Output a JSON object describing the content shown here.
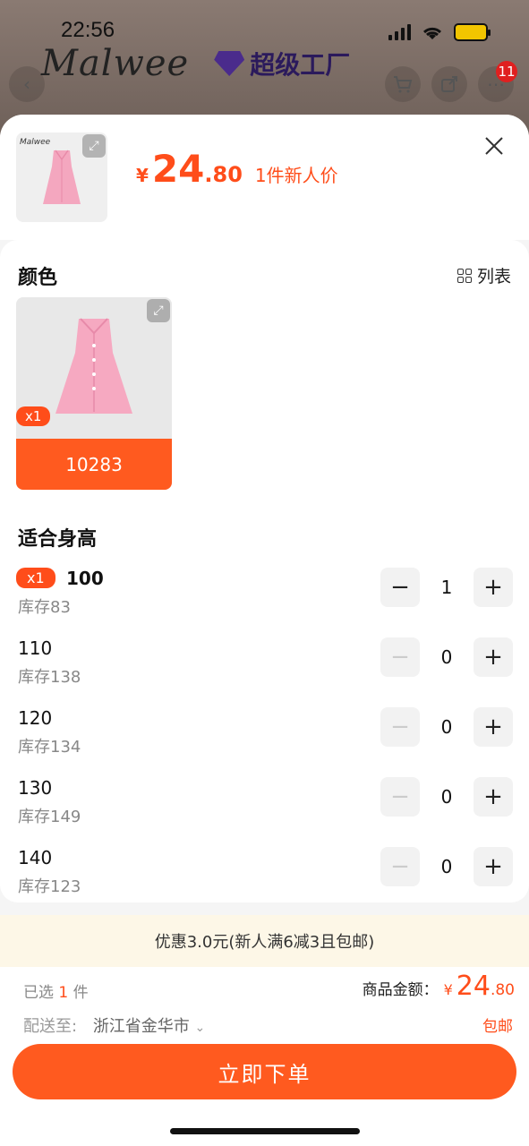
{
  "status": {
    "time": "22:56"
  },
  "brand": {
    "logo_text": "Malwee",
    "factory_label": "超级工厂"
  },
  "nav": {
    "cart_badge": "11"
  },
  "header": {
    "price_symbol": "¥",
    "price_int": "24",
    "price_dec": ".80",
    "price_note": "1件新人价"
  },
  "color_section": {
    "title": "颜色",
    "list_toggle_label": "列表",
    "option": {
      "label": "10283",
      "qty_tag": "x1"
    }
  },
  "size_section": {
    "title": "适合身高",
    "sizes": [
      {
        "name": "100",
        "stock": "库存83",
        "qty": "1",
        "tag": "x1",
        "selected": true
      },
      {
        "name": "110",
        "stock": "库存138",
        "qty": "0"
      },
      {
        "name": "120",
        "stock": "库存134",
        "qty": "0"
      },
      {
        "name": "130",
        "stock": "库存149",
        "qty": "0"
      },
      {
        "name": "140",
        "stock": "库存123",
        "qty": "0"
      }
    ]
  },
  "promo": {
    "text": "优惠3.0元(新人满6减3且包邮)"
  },
  "footer": {
    "selected_prefix": "已选",
    "selected_count": "1",
    "selected_suffix": "件",
    "total_label": "商品金额：",
    "total_symbol": "¥",
    "total_int": "24",
    "total_dec": ".80",
    "ship_label": "配送至:",
    "ship_value": "浙江省金华市",
    "free_shipping": "包邮",
    "order_button": "立即下单"
  },
  "colors": {
    "accent": "#ff5a1f",
    "price": "#ff4d1a",
    "promo_bg": "#fdf7e7"
  }
}
